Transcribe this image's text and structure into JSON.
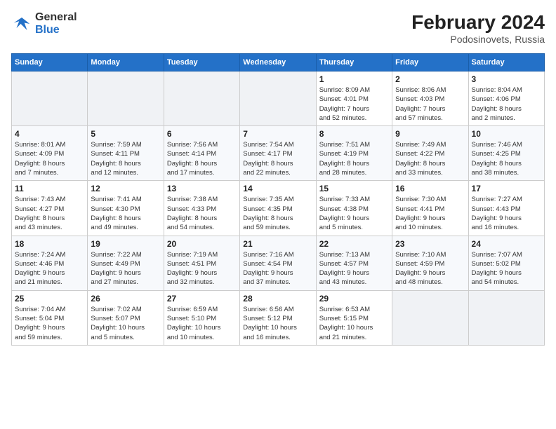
{
  "header": {
    "logo_line1": "General",
    "logo_line2": "Blue",
    "title": "February 2024",
    "subtitle": "Podosinovets, Russia"
  },
  "weekdays": [
    "Sunday",
    "Monday",
    "Tuesday",
    "Wednesday",
    "Thursday",
    "Friday",
    "Saturday"
  ],
  "weeks": [
    [
      {
        "day": "",
        "detail": ""
      },
      {
        "day": "",
        "detail": ""
      },
      {
        "day": "",
        "detail": ""
      },
      {
        "day": "",
        "detail": ""
      },
      {
        "day": "1",
        "detail": "Sunrise: 8:09 AM\nSunset: 4:01 PM\nDaylight: 7 hours\nand 52 minutes."
      },
      {
        "day": "2",
        "detail": "Sunrise: 8:06 AM\nSunset: 4:03 PM\nDaylight: 7 hours\nand 57 minutes."
      },
      {
        "day": "3",
        "detail": "Sunrise: 8:04 AM\nSunset: 4:06 PM\nDaylight: 8 hours\nand 2 minutes."
      }
    ],
    [
      {
        "day": "4",
        "detail": "Sunrise: 8:01 AM\nSunset: 4:09 PM\nDaylight: 8 hours\nand 7 minutes."
      },
      {
        "day": "5",
        "detail": "Sunrise: 7:59 AM\nSunset: 4:11 PM\nDaylight: 8 hours\nand 12 minutes."
      },
      {
        "day": "6",
        "detail": "Sunrise: 7:56 AM\nSunset: 4:14 PM\nDaylight: 8 hours\nand 17 minutes."
      },
      {
        "day": "7",
        "detail": "Sunrise: 7:54 AM\nSunset: 4:17 PM\nDaylight: 8 hours\nand 22 minutes."
      },
      {
        "day": "8",
        "detail": "Sunrise: 7:51 AM\nSunset: 4:19 PM\nDaylight: 8 hours\nand 28 minutes."
      },
      {
        "day": "9",
        "detail": "Sunrise: 7:49 AM\nSunset: 4:22 PM\nDaylight: 8 hours\nand 33 minutes."
      },
      {
        "day": "10",
        "detail": "Sunrise: 7:46 AM\nSunset: 4:25 PM\nDaylight: 8 hours\nand 38 minutes."
      }
    ],
    [
      {
        "day": "11",
        "detail": "Sunrise: 7:43 AM\nSunset: 4:27 PM\nDaylight: 8 hours\nand 43 minutes."
      },
      {
        "day": "12",
        "detail": "Sunrise: 7:41 AM\nSunset: 4:30 PM\nDaylight: 8 hours\nand 49 minutes."
      },
      {
        "day": "13",
        "detail": "Sunrise: 7:38 AM\nSunset: 4:33 PM\nDaylight: 8 hours\nand 54 minutes."
      },
      {
        "day": "14",
        "detail": "Sunrise: 7:35 AM\nSunset: 4:35 PM\nDaylight: 8 hours\nand 59 minutes."
      },
      {
        "day": "15",
        "detail": "Sunrise: 7:33 AM\nSunset: 4:38 PM\nDaylight: 9 hours\nand 5 minutes."
      },
      {
        "day": "16",
        "detail": "Sunrise: 7:30 AM\nSunset: 4:41 PM\nDaylight: 9 hours\nand 10 minutes."
      },
      {
        "day": "17",
        "detail": "Sunrise: 7:27 AM\nSunset: 4:43 PM\nDaylight: 9 hours\nand 16 minutes."
      }
    ],
    [
      {
        "day": "18",
        "detail": "Sunrise: 7:24 AM\nSunset: 4:46 PM\nDaylight: 9 hours\nand 21 minutes."
      },
      {
        "day": "19",
        "detail": "Sunrise: 7:22 AM\nSunset: 4:49 PM\nDaylight: 9 hours\nand 27 minutes."
      },
      {
        "day": "20",
        "detail": "Sunrise: 7:19 AM\nSunset: 4:51 PM\nDaylight: 9 hours\nand 32 minutes."
      },
      {
        "day": "21",
        "detail": "Sunrise: 7:16 AM\nSunset: 4:54 PM\nDaylight: 9 hours\nand 37 minutes."
      },
      {
        "day": "22",
        "detail": "Sunrise: 7:13 AM\nSunset: 4:57 PM\nDaylight: 9 hours\nand 43 minutes."
      },
      {
        "day": "23",
        "detail": "Sunrise: 7:10 AM\nSunset: 4:59 PM\nDaylight: 9 hours\nand 48 minutes."
      },
      {
        "day": "24",
        "detail": "Sunrise: 7:07 AM\nSunset: 5:02 PM\nDaylight: 9 hours\nand 54 minutes."
      }
    ],
    [
      {
        "day": "25",
        "detail": "Sunrise: 7:04 AM\nSunset: 5:04 PM\nDaylight: 9 hours\nand 59 minutes."
      },
      {
        "day": "26",
        "detail": "Sunrise: 7:02 AM\nSunset: 5:07 PM\nDaylight: 10 hours\nand 5 minutes."
      },
      {
        "day": "27",
        "detail": "Sunrise: 6:59 AM\nSunset: 5:10 PM\nDaylight: 10 hours\nand 10 minutes."
      },
      {
        "day": "28",
        "detail": "Sunrise: 6:56 AM\nSunset: 5:12 PM\nDaylight: 10 hours\nand 16 minutes."
      },
      {
        "day": "29",
        "detail": "Sunrise: 6:53 AM\nSunset: 5:15 PM\nDaylight: 10 hours\nand 21 minutes."
      },
      {
        "day": "",
        "detail": ""
      },
      {
        "day": "",
        "detail": ""
      }
    ]
  ]
}
